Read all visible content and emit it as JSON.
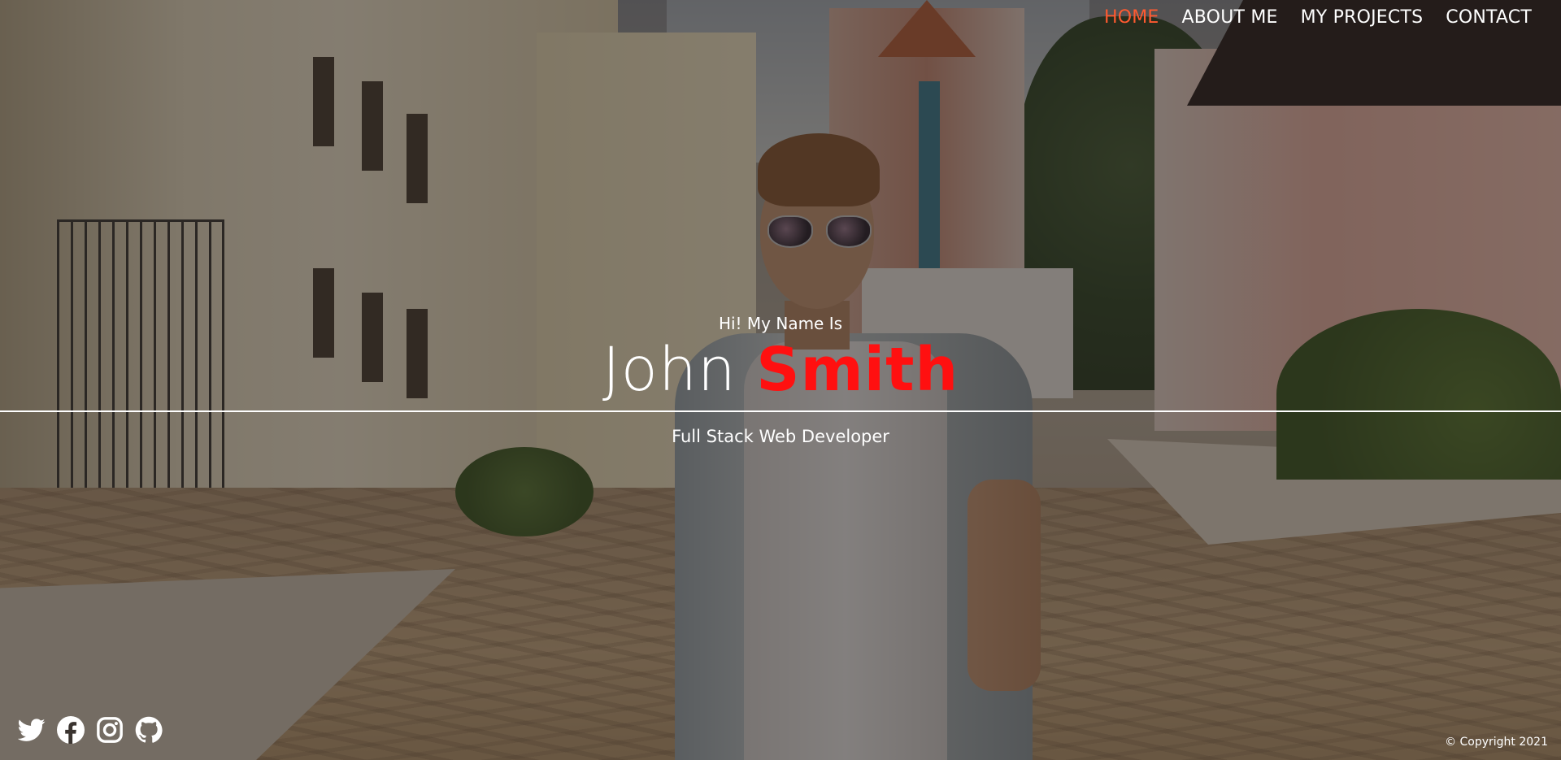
{
  "nav": {
    "items": [
      {
        "label": "HOME",
        "active": true
      },
      {
        "label": "ABOUT ME",
        "active": false
      },
      {
        "label": "MY PROJECTS",
        "active": false
      },
      {
        "label": "CONTACT",
        "active": false
      }
    ],
    "active_color": "#ff5a30"
  },
  "hero": {
    "greeting": "Hi! My Name Is",
    "first_name": "John",
    "last_name": "Smith",
    "last_name_color": "#ff1010",
    "role": "Full Stack Web Developer"
  },
  "social": {
    "icons": [
      "twitter-icon",
      "facebook-icon",
      "instagram-icon",
      "github-icon"
    ]
  },
  "footer": {
    "copyright": "© Copyright 2021"
  }
}
